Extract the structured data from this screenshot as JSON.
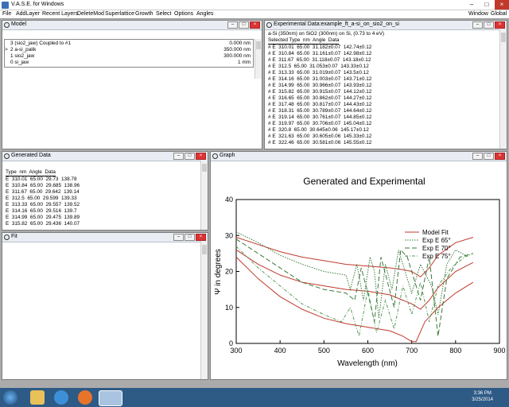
{
  "app": {
    "title": "V.A.S.E. for Windows"
  },
  "menu": {
    "items": [
      "File",
      "AddLayer",
      "Recent Layers",
      "DeleteMod",
      "Superlattice",
      "Growth",
      "Select",
      "Options",
      "Angles"
    ],
    "right_items": [
      "Window",
      "Global"
    ]
  },
  "model": {
    "title": "Model",
    "layers": [
      {
        "marker": "",
        "name": "3 (sio2_jaw) Coupled to #1",
        "value": "0.000 nm"
      },
      {
        "marker": ">",
        "name": "2 a-si_palik",
        "value": "350.000 nm"
      },
      {
        "marker": "",
        "name": "1 sio2_jaw",
        "value": "300.000 nm"
      },
      {
        "marker": "",
        "name": "0 si_jaw",
        "value": "1 mm"
      }
    ]
  },
  "experimental": {
    "title": "Experimental Data:example_ft_a-si_on_sio2_on_si",
    "description": "a-Si (350nm) on SiO2 (300nm) on Si, (0.73 to 4 eV)",
    "header": "Selected Type  nm  Angle  Data",
    "rows": [
      "# E  310.01  65.00  31.182±0.07  142.74±0.12",
      "# E  310.84  65.00  31.161±0.07  142.98±0.12",
      "# E  311.67  65.00  31.118±0.07  143.18±0.12",
      "# E  312.5  65.00  31.053±0.07  143.33±0.12",
      "# E  313.33  65.00  31.019±0.07  143.5±0.12",
      "# E  314.16  65.00  31.003±0.07  143.71±0.12",
      "# E  314.99  65.00  30.966±0.07  143.93±0.12",
      "# E  315.82  65.00  30.915±0.07  144.12±0.12",
      "# E  316.65  65.00  30.862±0.07  144.27±0.12",
      "# E  317.48  65.00  30.817±0.07  144.43±0.12",
      "# E  318.31  65.00  30.789±0.07  144.64±0.12",
      "# E  319.14  65.00  30.761±0.07  144.85±0.12",
      "# E  319.97  65.00  30.706±0.07  145.04±0.12",
      "# E  320.8  65.00  30.645±0.06  145.17±0.12",
      "# E  321.63  65.00  30.605±0.06  145.33±0.12",
      "# E  322.46  65.00  30.581±0.06  145.55±0.12"
    ]
  },
  "generated": {
    "title": "Generated Data",
    "header": "Type  nm  Angle  Data",
    "rows": [
      "E  310.01  65.00  29.73  138.78",
      "E  310.84  65.00  29.685  138.96",
      "E  311.67  65.00  29.642  139.14",
      "E  312.5  65.00  29.599  139.33",
      "E  313.33  65.00  29.557  139.52",
      "E  314.16  65.00  29.516  139.7",
      "E  314.99  65.00  29.475  139.89",
      "E  315.82  65.00  29.436  140.07",
      "E  316.65  65.00  29.395  140.25"
    ]
  },
  "fit": {
    "title": "Fit"
  },
  "graph": {
    "title": "Graph"
  },
  "chart_data": {
    "type": "line",
    "title": "Generated and Experimental",
    "xlabel": "Wavelength (nm)",
    "ylabel": "Ψ in degrees",
    "xlim": [
      300,
      900
    ],
    "ylim": [
      0,
      40
    ],
    "xticks": [
      300,
      400,
      500,
      600,
      700,
      800,
      900
    ],
    "yticks": [
      0,
      10,
      20,
      30,
      40
    ],
    "legend_position": "top-right",
    "legend": [
      "Model Fit",
      "Exp E 65°",
      "Exp E 70°",
      "Exp E 75°"
    ],
    "series": [
      {
        "name": "Model Fit",
        "color": "#c0392b",
        "dash": "",
        "x": [
          300,
          350,
          400,
          450,
          500,
          550,
          600,
          650,
          680,
          700,
          720,
          740,
          760,
          800,
          840
        ],
        "y": [
          29.5,
          27.5,
          25.5,
          24,
          23,
          22,
          21.5,
          21,
          20.5,
          20,
          18.5,
          21,
          24.5,
          28,
          29.5
        ]
      },
      {
        "name": "Model Fit",
        "color": "#c0392b",
        "dash": "",
        "x": [
          300,
          350,
          400,
          450,
          500,
          550,
          600,
          650,
          700,
          720,
          740,
          760,
          800,
          840
        ],
        "y": [
          26,
          22,
          19,
          17,
          16,
          15,
          14.5,
          13.5,
          11,
          9.5,
          12,
          15.5,
          20,
          22.5
        ]
      },
      {
        "name": "Model Fit",
        "color": "#c0392b",
        "dash": "",
        "x": [
          300,
          350,
          400,
          450,
          500,
          550,
          600,
          650,
          680,
          700,
          710,
          730,
          760,
          800,
          840
        ],
        "y": [
          24,
          18,
          13,
          9.5,
          7,
          5.5,
          4.5,
          3.5,
          2,
          0.5,
          0.5,
          6,
          10,
          14,
          17
        ]
      },
      {
        "name": "Exp E 65°",
        "color": "#3a7a3a",
        "dash": "1.5,1.5",
        "x": [
          300,
          350,
          400,
          450,
          500,
          550,
          560,
          575,
          590,
          605,
          615,
          625,
          640,
          655,
          670,
          685,
          700,
          720,
          745,
          760,
          780,
          800,
          830
        ],
        "y": [
          31,
          28,
          24.5,
          22,
          20,
          19,
          15,
          22,
          12,
          24,
          20,
          7,
          22,
          15,
          26,
          20,
          14,
          22,
          16,
          8,
          22,
          26,
          24
        ]
      },
      {
        "name": "Exp E 70°",
        "color": "#3a7a3a",
        "dash": "6,3",
        "x": [
          300,
          350,
          400,
          450,
          500,
          550,
          570,
          585,
          600,
          615,
          630,
          645,
          660,
          675,
          690,
          705,
          720,
          740,
          760,
          780,
          810,
          840
        ],
        "y": [
          29,
          25,
          21,
          17,
          15,
          14,
          12,
          21,
          14,
          6,
          24,
          17,
          10,
          26,
          24,
          18,
          12,
          24,
          2,
          18,
          24,
          25
        ]
      },
      {
        "name": "Exp E 75°",
        "color": "#5a9a5a",
        "dash": "4,2,1,2",
        "x": [
          300,
          350,
          400,
          450,
          500,
          540,
          560,
          580,
          600,
          620,
          640,
          660,
          680,
          700,
          720,
          740,
          760,
          790,
          820,
          840
        ],
        "y": [
          27,
          21,
          16,
          11,
          8,
          6,
          10,
          2,
          15,
          3,
          12,
          4,
          16,
          8,
          17,
          6,
          16,
          21,
          24,
          25
        ]
      }
    ]
  },
  "taskbar": {
    "icons": [
      "start-orb-icon",
      "explorer-icon",
      "ie-icon",
      "firefox-icon",
      "vase-app-icon"
    ],
    "time": "3:36 PM",
    "date": "3/25/2014"
  }
}
